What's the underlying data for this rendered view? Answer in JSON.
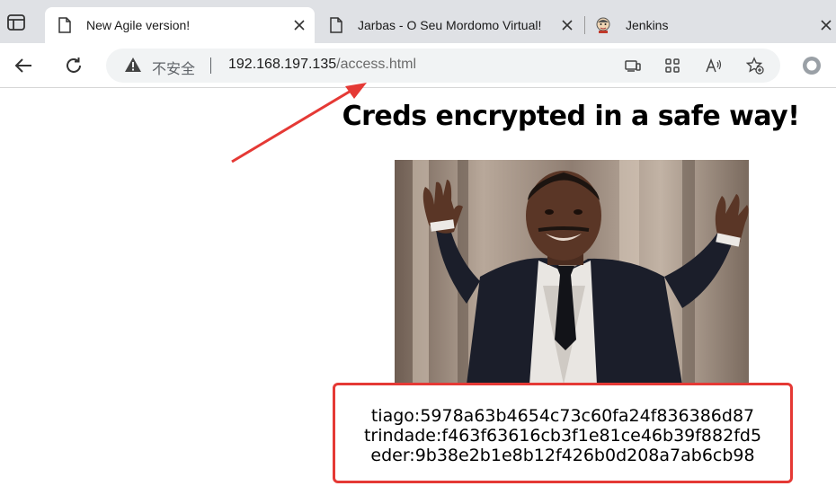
{
  "browser": {
    "tabs": [
      {
        "title": "New Agile version!",
        "icon": "document-icon",
        "active": true
      },
      {
        "title": "Jarbas - O Seu Mordomo Virtual!",
        "icon": "document-icon",
        "active": false
      },
      {
        "title": "Jenkins",
        "icon": "jenkins-icon",
        "active": false
      }
    ],
    "address_bar": {
      "security_label": "不安全",
      "host": "192.168.197.135",
      "path": "/access.html"
    }
  },
  "page": {
    "heading": "Creds encrypted in a safe way!",
    "image_subject": "man in tuxedo with raised hands",
    "credentials": [
      "tiago:5978a63b4654c73c60fa24f836386d87",
      "trindade:f463f63616cb3f1e81ce46b39f882fd5",
      "eder:9b38e2b1e8b12f426b0d208a7ab6cb98"
    ]
  },
  "annotations": {
    "color": "#e53935"
  }
}
